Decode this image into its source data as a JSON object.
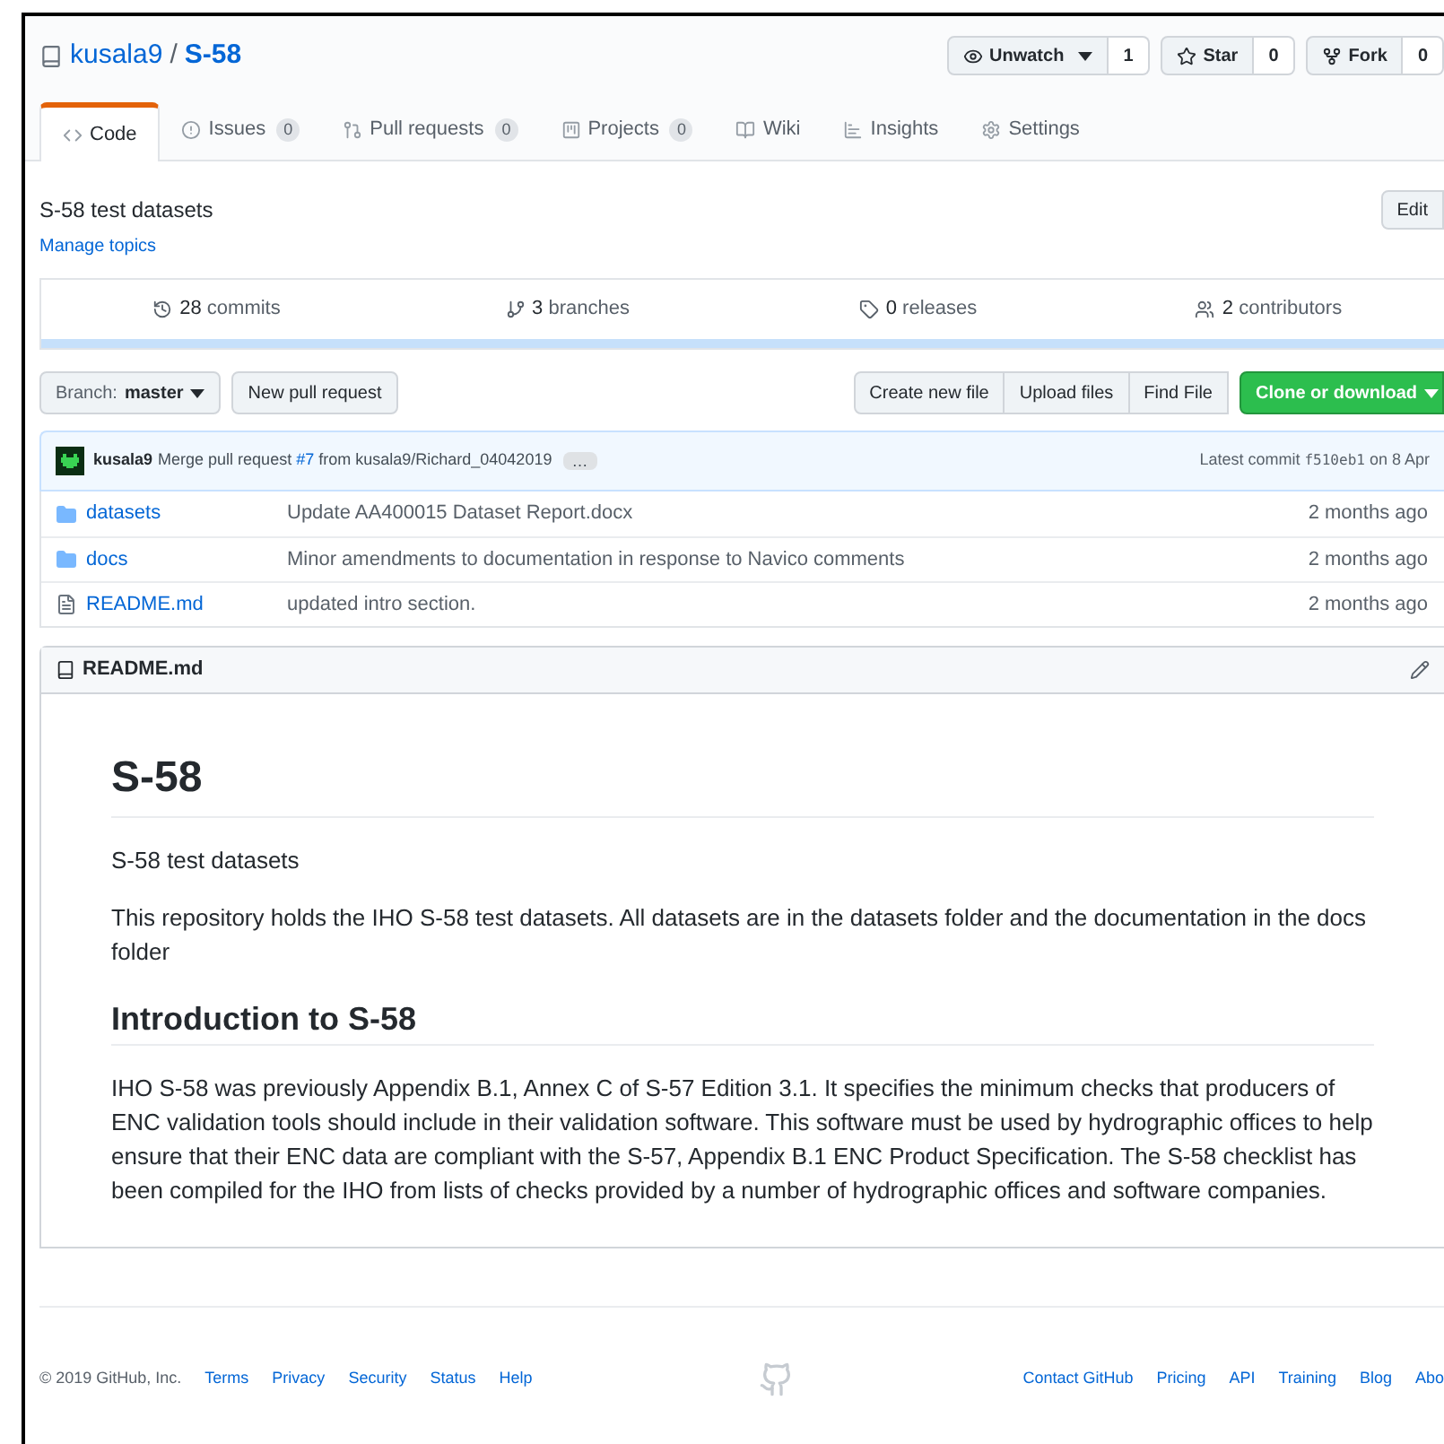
{
  "repo": {
    "owner": "kusala9",
    "separator": "/",
    "name": "S-58"
  },
  "actions": [
    {
      "label": "Unwatch",
      "count": "1",
      "kind": "watch"
    },
    {
      "label": "Star",
      "count": "0",
      "kind": "star"
    },
    {
      "label": "Fork",
      "count": "0",
      "kind": "fork"
    }
  ],
  "tabs": [
    {
      "label": "Code",
      "selected": true,
      "kind": "code"
    },
    {
      "label": "Issues",
      "count": "0",
      "selected": false,
      "kind": "issues"
    },
    {
      "label": "Pull requests",
      "count": "0",
      "selected": false,
      "kind": "pr"
    },
    {
      "label": "Projects",
      "count": "0",
      "selected": false,
      "kind": "projects"
    },
    {
      "label": "Wiki",
      "selected": false,
      "kind": "wiki"
    },
    {
      "label": "Insights",
      "selected": false,
      "kind": "insights"
    },
    {
      "label": "Settings",
      "selected": false,
      "kind": "settings"
    }
  ],
  "description": "S-58 test datasets",
  "edit_button": "Edit",
  "manage_topics": "Manage topics",
  "stats": [
    {
      "count": "28",
      "label": "commits",
      "kind": "commits"
    },
    {
      "count": "3",
      "label": "branches",
      "kind": "branches"
    },
    {
      "count": "0",
      "label": "releases",
      "kind": "releases"
    },
    {
      "count": "2",
      "label": "contributors",
      "kind": "contributors"
    }
  ],
  "branch": {
    "label": "Branch:",
    "value": "master"
  },
  "new_pr": "New pull request",
  "file_buttons": [
    "Create new file",
    "Upload files",
    "Find File"
  ],
  "clone": "Clone or download",
  "commit": {
    "author": "kusala9",
    "message_before": "Merge pull request",
    "link": "#7",
    "message_after": "from kusala9/Richard_04042019",
    "ellipsis": "…",
    "latest": "Latest commit",
    "sha": "f510eb1",
    "date": "on 8 Apr"
  },
  "files": [
    {
      "name": "datasets",
      "kind": "folder",
      "message": "Update AA400015 Dataset Report.docx",
      "age": "2 months ago"
    },
    {
      "name": "docs",
      "kind": "folder",
      "message": "Minor amendments to documentation in response to Navico comments",
      "age": "2 months ago"
    },
    {
      "name": "README.md",
      "kind": "file",
      "message": "updated intro section.",
      "age": "2 months ago"
    }
  ],
  "readme": {
    "title": "README.md",
    "h1": "S-58",
    "subtitle": "S-58 test datasets",
    "intro": "This repository holds the IHO S-58 test datasets. All datasets are in the datasets folder and the documentation in the docs folder",
    "h2": "Introduction to S-58",
    "body": "IHO S-58 was previously Appendix B.1, Annex C of S-57 Edition 3.1. It specifies the minimum checks that producers of ENC validation tools should include in their validation software. This software must be used by hydrographic offices to help ensure that their ENC data are compliant with the S-57, Appendix B.1 ENC Product Specification. The S-58 checklist has been compiled for the IHO from lists of checks provided by a number of hydrographic offices and software companies."
  },
  "footer": {
    "copyright": "© 2019 GitHub, Inc.",
    "left_links": [
      "Terms",
      "Privacy",
      "Security",
      "Status",
      "Help"
    ],
    "right_links": [
      "Contact GitHub",
      "Pricing",
      "API",
      "Training",
      "Blog",
      "Abo"
    ]
  }
}
